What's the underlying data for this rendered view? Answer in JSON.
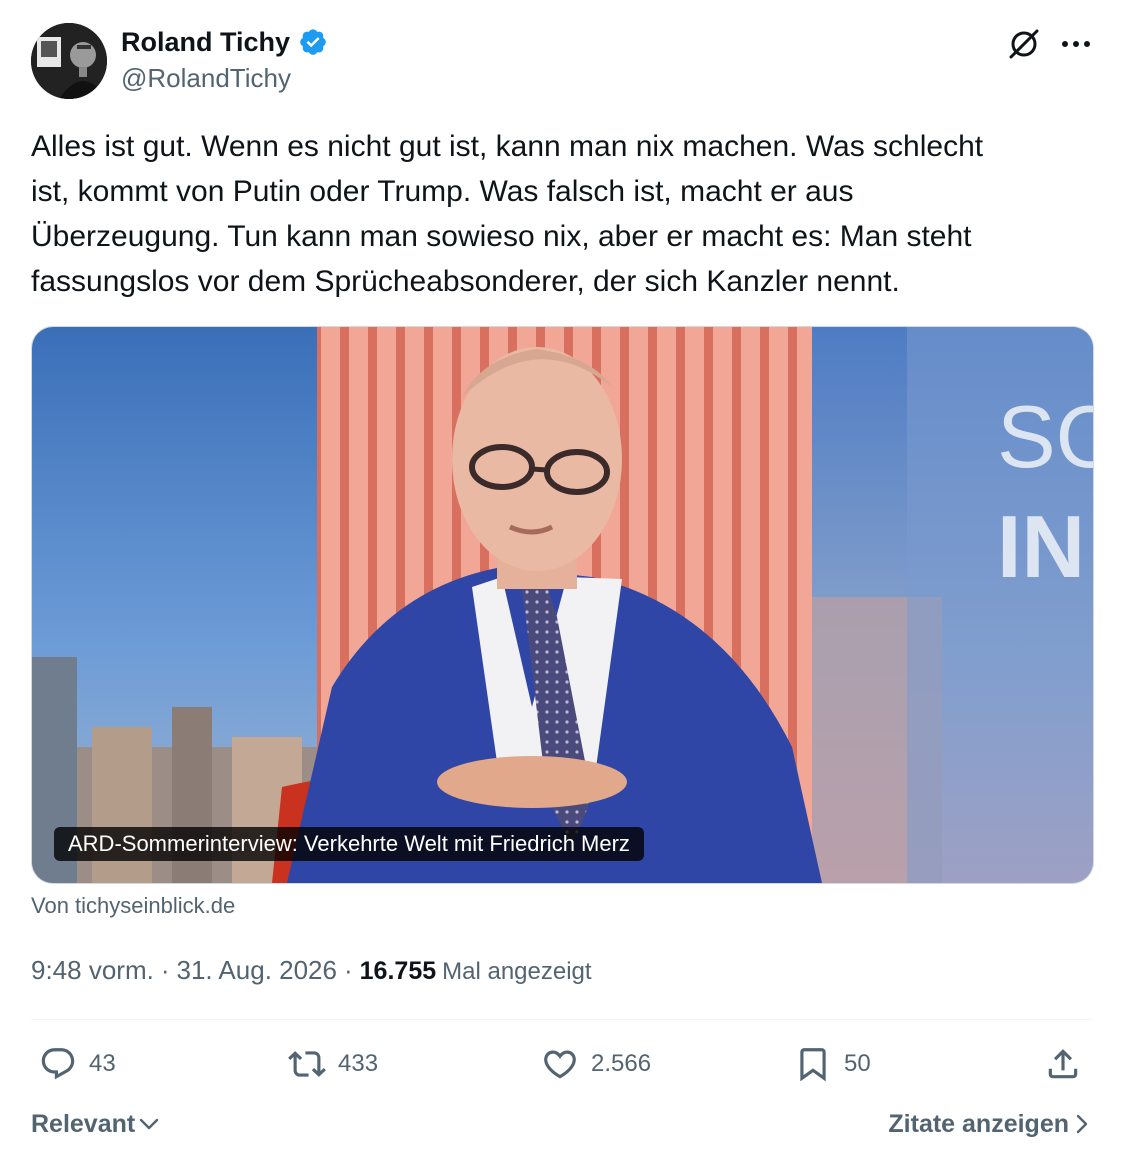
{
  "author": {
    "name": "Roland Tichy",
    "handle": "@RolandTichy",
    "verified_color": "#1d9bf0"
  },
  "icons": {
    "verified": "verified-badge-icon",
    "grok": "grok-icon",
    "more": "more-icon",
    "reply": "reply-icon",
    "retweet": "retweet-icon",
    "like": "like-icon",
    "bookmark": "bookmark-icon",
    "share": "share-icon"
  },
  "tweet": {
    "text_lines": [
      "Alles ist gut. Wenn es nicht gut ist, kann man nix machen. Was schlecht",
      "ist, kommt von Putin oder Trump. Was falsch ist, macht er aus",
      "Überzeugung. Tun kann man sowieso nix, aber er macht es: Man steht",
      "fassungslos vor dem Sprücheabsonderer, der sich Kanzler nennt."
    ]
  },
  "card": {
    "caption": "ARD-Sommerinterview: Verkehrte Welt mit Friedrich Merz",
    "background_text_top": "SO",
    "background_text_bottom": "IN",
    "source": "Von tichyseinblick.de"
  },
  "meta": {
    "time": "9:48 vorm.",
    "date": "31. Aug. 2026",
    "separator": "·",
    "views": "16.755",
    "views_label": "Mal angezeigt"
  },
  "actions": {
    "replies": "43",
    "retweets": "433",
    "likes": "2.566",
    "bookmarks": "50"
  },
  "footer": {
    "sort_label": "Relevant",
    "quotes_label": "Zitate anzeigen"
  },
  "colors": {
    "text": "#0f1419",
    "secondary": "#536471",
    "divider": "#eff3f4",
    "accent": "#1d9bf0"
  }
}
